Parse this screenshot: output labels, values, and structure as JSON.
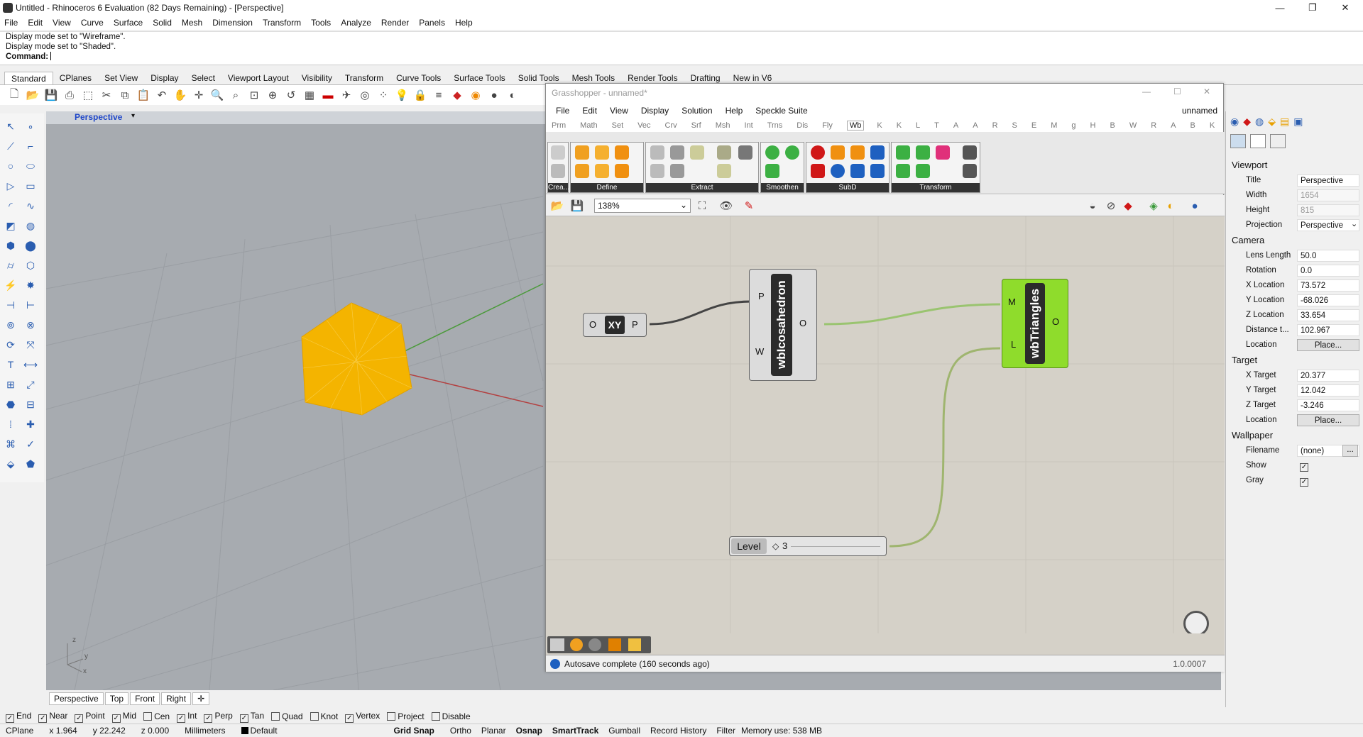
{
  "window": {
    "title": "Untitled - Rhinoceros 6 Evaluation (82 Days Remaining) - [Perspective]"
  },
  "menu": [
    "File",
    "Edit",
    "View",
    "Curve",
    "Surface",
    "Solid",
    "Mesh",
    "Dimension",
    "Transform",
    "Tools",
    "Analyze",
    "Render",
    "Panels",
    "Help"
  ],
  "command": {
    "history": [
      "Display mode set to \"Wireframe\".",
      "Display mode set to \"Shaded\"."
    ],
    "prompt": "Command:"
  },
  "toolbar_tabs": [
    "Standard",
    "CPlanes",
    "Set View",
    "Display",
    "Select",
    "Viewport Layout",
    "Visibility",
    "Transform",
    "Curve Tools",
    "Surface Tools",
    "Solid Tools",
    "Mesh Tools",
    "Render Tools",
    "Drafting",
    "New in V6"
  ],
  "viewport": {
    "title": "Perspective",
    "tabs": [
      "Perspective",
      "Top",
      "Front",
      "Right"
    ],
    "axis_labels": {
      "z": "z",
      "y": "y",
      "x": "x"
    }
  },
  "osnaps": [
    {
      "label": "End",
      "checked": true
    },
    {
      "label": "Near",
      "checked": true
    },
    {
      "label": "Point",
      "checked": true
    },
    {
      "label": "Mid",
      "checked": true
    },
    {
      "label": "Cen",
      "checked": false
    },
    {
      "label": "Int",
      "checked": true
    },
    {
      "label": "Perp",
      "checked": true
    },
    {
      "label": "Tan",
      "checked": true
    },
    {
      "label": "Quad",
      "checked": false
    },
    {
      "label": "Knot",
      "checked": false
    },
    {
      "label": "Vertex",
      "checked": true
    },
    {
      "label": "Project",
      "checked": false
    },
    {
      "label": "Disable",
      "checked": false
    }
  ],
  "status": {
    "cplane": "CPlane",
    "x": "x 1.964",
    "y": "y 22.242",
    "z": "z 0.000",
    "units": "Millimeters",
    "layer": "Default",
    "toggles": [
      "Grid Snap",
      "Ortho",
      "Planar",
      "Osnap",
      "SmartTrack",
      "Gumball",
      "Record History",
      "Filter"
    ],
    "memory": "Memory use: 538 MB"
  },
  "grasshopper": {
    "title": "Grasshopper - unnamed*",
    "menu": [
      "File",
      "Edit",
      "View",
      "Display",
      "Solution",
      "Help",
      "Speckle Suite"
    ],
    "doc_name": "unnamed",
    "tabs": [
      "Prm",
      "Math",
      "Set",
      "Vec",
      "Crv",
      "Srf",
      "Msh",
      "Int",
      "Trns",
      "Dis",
      "Fly",
      "Wb",
      "K",
      "K",
      "L",
      "T",
      "A",
      "A",
      "R",
      "S",
      "E",
      "M",
      "g",
      "H",
      "B",
      "W",
      "R",
      "A",
      "B",
      "K"
    ],
    "active_tab": "Wb",
    "groups": [
      "Crea...",
      "Define",
      "Extract",
      "Smoothen",
      "SubD",
      "Transform"
    ],
    "zoom": "138%",
    "components": {
      "xy": {
        "label": "XY",
        "in": "O",
        "out": "P"
      },
      "ico": {
        "label": "wbIcosahedron",
        "in1": "P",
        "in2": "W",
        "out": "O"
      },
      "tri": {
        "label": "wbTriangles",
        "in1": "M",
        "in2": "L",
        "out": "O"
      },
      "slider": {
        "label": "Level",
        "value": "3"
      }
    },
    "status": "Autosave complete (160 seconds ago)",
    "version": "1.0.0007"
  },
  "properties": {
    "viewport_header": "Viewport",
    "viewport": [
      {
        "k": "Title",
        "v": "Perspective"
      },
      {
        "k": "Width",
        "v": "1654"
      },
      {
        "k": "Height",
        "v": "815"
      },
      {
        "k": "Projection",
        "v": "Perspective"
      }
    ],
    "camera_header": "Camera",
    "camera": [
      {
        "k": "Lens Length",
        "v": "50.0"
      },
      {
        "k": "Rotation",
        "v": "0.0"
      },
      {
        "k": "X Location",
        "v": "73.572"
      },
      {
        "k": "Y Location",
        "v": "-68.026"
      },
      {
        "k": "Z Location",
        "v": "33.654"
      },
      {
        "k": "Distance t...",
        "v": "102.967"
      },
      {
        "k": "Location",
        "v": "Place..."
      }
    ],
    "target_header": "Target",
    "target": [
      {
        "k": "X Target",
        "v": "20.377"
      },
      {
        "k": "Y Target",
        "v": "12.042"
      },
      {
        "k": "Z Target",
        "v": "-3.246"
      },
      {
        "k": "Location",
        "v": "Place..."
      }
    ],
    "wallpaper_header": "Wallpaper",
    "wallpaper": [
      {
        "k": "Filename",
        "v": "(none)"
      },
      {
        "k": "Show",
        "v": ""
      },
      {
        "k": "Gray",
        "v": ""
      }
    ],
    "ellipsis": "..."
  },
  "colors": {
    "viewport_bg": "#a7abb0",
    "icosahedron": "#f4b400",
    "gh_canvas": "#d5d1c8",
    "triangles_comp": "#8fdc2c",
    "wire_green": "#8cc63f"
  }
}
